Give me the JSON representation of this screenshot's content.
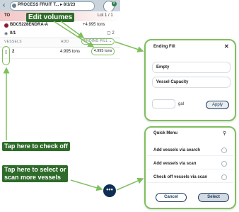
{
  "header": {
    "back_glyph": "‹",
    "title": "PROCESS FRUIT T...",
    "date": "8/1/23",
    "badge": "8"
  },
  "summary": {
    "to_label": "TO",
    "lot_label": "Lot 1 / 1",
    "vessel_code": "BDC5228ENDRA-A",
    "vessel_amount": "+4.995 tons",
    "count_text": "0/1",
    "count_right": "2"
  },
  "table": {
    "col_vessels": "VESSELS",
    "col_add": "ADD",
    "col_ending_fill": "ENDING FILL ⌄",
    "rows": [
      {
        "vessel": "2",
        "add": "4.995 tons",
        "ending": "4.995 tons"
      }
    ]
  },
  "fab_label": "•••",
  "annotations": {
    "edit_volumes": "Edit volumes",
    "check_off": "Tap here to check off",
    "select_line1": "Tap here to select or",
    "select_line2": "scan more vessels"
  },
  "ending_fill": {
    "title": "Ending Fill",
    "close": "✕",
    "options": [
      "Empty",
      "Vessel Capacity"
    ],
    "unit": "gal",
    "apply": "Apply"
  },
  "quick_menu": {
    "title": "Quick Menu",
    "items": [
      "Add vessels via search",
      "Add vessels via scan",
      "Check off vessels via scan"
    ],
    "cancel": "Cancel",
    "select": "Select"
  },
  "colors": {
    "accent_green": "#7fbf5e",
    "navy": "#0f2e54",
    "annotation_bg": "#2e6b2a"
  }
}
